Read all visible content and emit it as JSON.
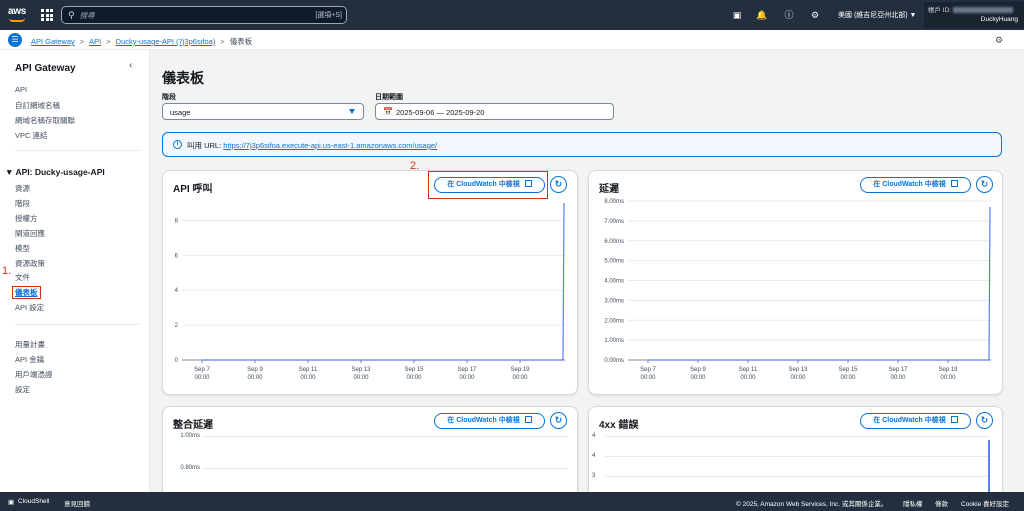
{
  "topbar": {
    "logo": "aws",
    "search_placeholder": "搜尋",
    "search_shortcut": "[選項+S]",
    "region": "美國 (維吉尼亞州北部) ▼",
    "account_label": "帳戶 ID:",
    "username": "DuckyHuang"
  },
  "breadcrumb": {
    "items": [
      "API Gateway",
      "API",
      "Ducky-usage-API (7j3p6sifoa)"
    ],
    "current": "儀表板"
  },
  "sidebar": {
    "title": "API Gateway",
    "top_items": [
      "API",
      "自訂網域名稱",
      "網域名稱存取關聯",
      "VPC 連結"
    ],
    "section_title": "▼ API: Ducky-usage-API",
    "api_items": [
      "資源",
      "階段",
      "授權方",
      "閘道回應",
      "模型",
      "資源政策",
      "文件",
      "儀表板",
      "API 設定"
    ],
    "bottom_items": [
      "用量計畫",
      "API 金鑰",
      "用戶端憑證",
      "設定"
    ]
  },
  "annotations": {
    "step1": "1.",
    "step2": "2."
  },
  "main": {
    "title": "儀表板",
    "stage_label": "階段",
    "stage_value": "usage",
    "date_label": "日期範圍",
    "date_value": "2025-09-06 — 2025-09-20",
    "invoke_label": "叫用 URL: ",
    "invoke_url": "https://7j3p6sifoa.execute-api.us-east-1.amazonaws.com/usage/"
  },
  "cards": {
    "api_calls": {
      "title": "API 呼叫",
      "button": "在 CloudWatch 中檢視"
    },
    "latency": {
      "title": "延遲",
      "button": "在 CloudWatch 中檢視"
    },
    "integration": {
      "title": "整合延遲",
      "button": "在 CloudWatch 中檢視"
    },
    "errors4xx": {
      "title": "4xx 錯誤",
      "button": "在 CloudWatch 中檢視"
    }
  },
  "x_ticks": [
    [
      "Sep 7",
      "00:00"
    ],
    [
      "Sep 9",
      "00:00"
    ],
    [
      "Sep 11",
      "00:00"
    ],
    [
      "Sep 13",
      "00:00"
    ],
    [
      "Sep 15",
      "00:00"
    ],
    [
      "Sep 17",
      "00:00"
    ],
    [
      "Sep 19",
      "00:00"
    ]
  ],
  "y_ticks": {
    "api_calls": [
      "8",
      "6",
      "4",
      "2",
      "0"
    ],
    "latency": [
      "8.00ms",
      "7.00ms",
      "6.00ms",
      "5.00ms",
      "4.00ms",
      "3.00ms",
      "2.00ms",
      "1.00ms",
      "0.00ms"
    ],
    "integration": [
      "1.00ms",
      "0.80ms"
    ],
    "errors4xx": [
      "4",
      "4",
      "3"
    ]
  },
  "bottombar": {
    "cloudshell": "CloudShell",
    "feedback": "意見回饋",
    "copyright": "© 2025, Amazon Web Services, Inc. 或其關係企業。",
    "privacy": "隱私權",
    "terms": "條款",
    "cookie": "Cookie 喜好設定"
  },
  "colors": {
    "accent": "#0972d3",
    "nav": "#232f3e",
    "annotation": "#d13212",
    "series": "#5b7ff0"
  },
  "chart_data": [
    {
      "type": "line",
      "title": "API 呼叫",
      "x": [
        "Sep 7 00:00",
        "Sep 9 00:00",
        "Sep 11 00:00",
        "Sep 13 00:00",
        "Sep 15 00:00",
        "Sep 17 00:00",
        "Sep 19 00:00"
      ],
      "series": [
        {
          "values": [
            0,
            0,
            0,
            0,
            0,
            0,
            0
          ]
        }
      ],
      "last_point_value": 9,
      "ylim": [
        0,
        9
      ]
    },
    {
      "type": "line",
      "title": "延遲",
      "x": [
        "Sep 7 00:00",
        "Sep 9 00:00",
        "Sep 11 00:00",
        "Sep 13 00:00",
        "Sep 15 00:00",
        "Sep 17 00:00",
        "Sep 19 00:00"
      ],
      "series": [
        {
          "values": [
            0,
            0,
            0,
            0,
            0,
            0,
            0
          ]
        }
      ],
      "last_point_value": 7.7,
      "ylim": [
        0,
        8
      ]
    }
  ]
}
